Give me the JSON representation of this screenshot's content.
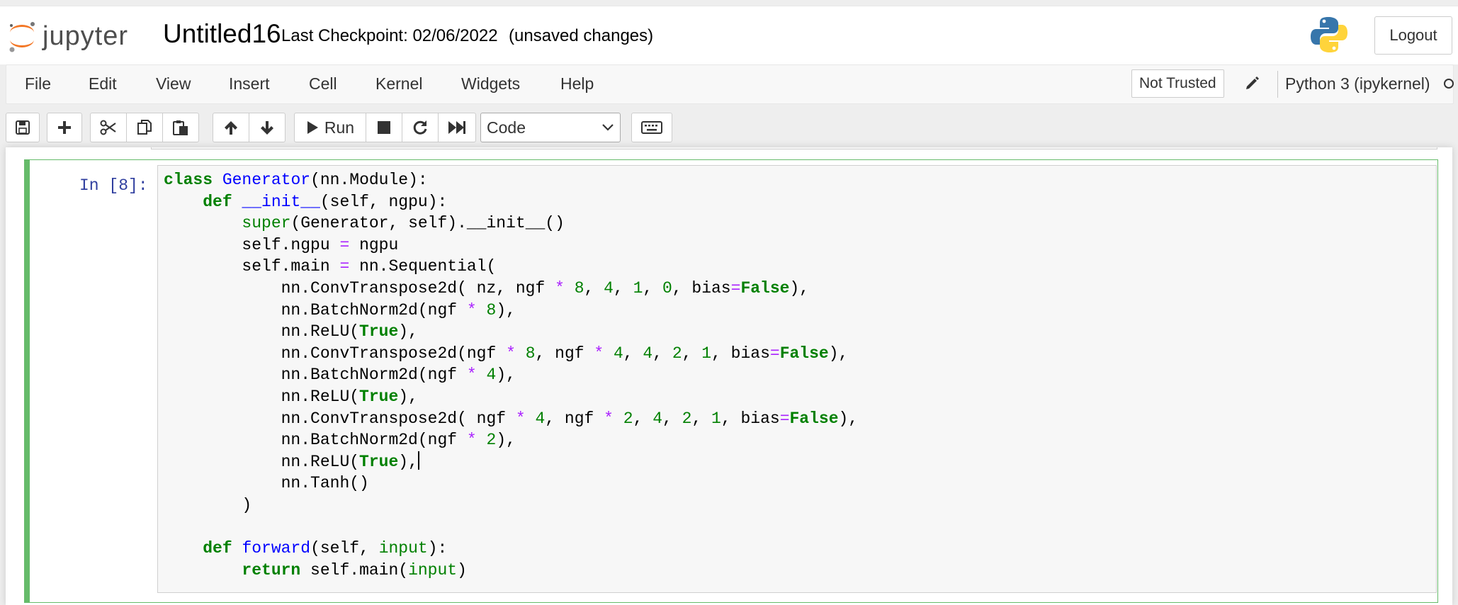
{
  "header": {
    "logo_text": "jupyter",
    "notebook_name": "Untitled16",
    "checkpoint": "Last Checkpoint: 02/06/2022",
    "unsaved": "(unsaved changes)",
    "logout_label": "Logout"
  },
  "menubar": {
    "items": [
      "File",
      "Edit",
      "View",
      "Insert",
      "Cell",
      "Kernel",
      "Widgets",
      "Help"
    ],
    "trust_label": "Not Trusted",
    "kernel_name": "Python 3 (ipykernel)"
  },
  "toolbar": {
    "run_label": "Run",
    "cell_type": "Code",
    "icons": [
      "save-icon",
      "plus-icon",
      "scissors-icon",
      "copy-icon",
      "paste-icon",
      "arrow-up-icon",
      "arrow-down-icon",
      "play-icon",
      "stop-icon",
      "restart-icon",
      "fast-forward-icon",
      "keyboard-icon"
    ]
  },
  "cell": {
    "prompt": "In [8]:",
    "lines": [
      [
        [
          "kw",
          "class"
        ],
        [
          "p",
          " "
        ],
        [
          "def",
          "Generator"
        ],
        [
          "p",
          "(nn.Module):"
        ]
      ],
      [
        [
          "p",
          "    "
        ],
        [
          "kw",
          "def"
        ],
        [
          "p",
          " "
        ],
        [
          "def",
          "__init__"
        ],
        [
          "p",
          "(self, ngpu):"
        ]
      ],
      [
        [
          "p",
          "        "
        ],
        [
          "bi",
          "super"
        ],
        [
          "p",
          "(Generator, self).__init__()"
        ]
      ],
      [
        [
          "p",
          "        self.ngpu "
        ],
        [
          "op",
          "="
        ],
        [
          "p",
          " ngpu"
        ]
      ],
      [
        [
          "p",
          "        self.main "
        ],
        [
          "op",
          "="
        ],
        [
          "p",
          " nn.Sequential("
        ]
      ],
      [
        [
          "p",
          "            nn.ConvTranspose2d( nz, ngf "
        ],
        [
          "op",
          "*"
        ],
        [
          "p",
          " "
        ],
        [
          "num",
          "8"
        ],
        [
          "p",
          ", "
        ],
        [
          "num",
          "4"
        ],
        [
          "p",
          ", "
        ],
        [
          "num",
          "1"
        ],
        [
          "p",
          ", "
        ],
        [
          "num",
          "0"
        ],
        [
          "p",
          ", bias"
        ],
        [
          "op",
          "="
        ],
        [
          "kw",
          "False"
        ],
        [
          "p",
          "),"
        ]
      ],
      [
        [
          "p",
          "            nn.BatchNorm2d(ngf "
        ],
        [
          "op",
          "*"
        ],
        [
          "p",
          " "
        ],
        [
          "num",
          "8"
        ],
        [
          "p",
          "),"
        ]
      ],
      [
        [
          "p",
          "            nn.ReLU("
        ],
        [
          "kw",
          "True"
        ],
        [
          "p",
          "),"
        ]
      ],
      [
        [
          "p",
          "            nn.ConvTranspose2d(ngf "
        ],
        [
          "op",
          "*"
        ],
        [
          "p",
          " "
        ],
        [
          "num",
          "8"
        ],
        [
          "p",
          ", ngf "
        ],
        [
          "op",
          "*"
        ],
        [
          "p",
          " "
        ],
        [
          "num",
          "4"
        ],
        [
          "p",
          ", "
        ],
        [
          "num",
          "4"
        ],
        [
          "p",
          ", "
        ],
        [
          "num",
          "2"
        ],
        [
          "p",
          ", "
        ],
        [
          "num",
          "1"
        ],
        [
          "p",
          ", bias"
        ],
        [
          "op",
          "="
        ],
        [
          "kw",
          "False"
        ],
        [
          "p",
          "),"
        ]
      ],
      [
        [
          "p",
          "            nn.BatchNorm2d(ngf "
        ],
        [
          "op",
          "*"
        ],
        [
          "p",
          " "
        ],
        [
          "num",
          "4"
        ],
        [
          "p",
          "),"
        ]
      ],
      [
        [
          "p",
          "            nn.ReLU("
        ],
        [
          "kw",
          "True"
        ],
        [
          "p",
          "),"
        ]
      ],
      [
        [
          "p",
          "            nn.ConvTranspose2d( ngf "
        ],
        [
          "op",
          "*"
        ],
        [
          "p",
          " "
        ],
        [
          "num",
          "4"
        ],
        [
          "p",
          ", ngf "
        ],
        [
          "op",
          "*"
        ],
        [
          "p",
          " "
        ],
        [
          "num",
          "2"
        ],
        [
          "p",
          ", "
        ],
        [
          "num",
          "4"
        ],
        [
          "p",
          ", "
        ],
        [
          "num",
          "2"
        ],
        [
          "p",
          ", "
        ],
        [
          "num",
          "1"
        ],
        [
          "p",
          ", bias"
        ],
        [
          "op",
          "="
        ],
        [
          "kw",
          "False"
        ],
        [
          "p",
          "),"
        ]
      ],
      [
        [
          "p",
          "            nn.BatchNorm2d(ngf "
        ],
        [
          "op",
          "*"
        ],
        [
          "p",
          " "
        ],
        [
          "num",
          "2"
        ],
        [
          "p",
          "),"
        ]
      ],
      [
        [
          "p",
          "            nn.ReLU("
        ],
        [
          "kw",
          "True"
        ],
        [
          "p",
          "),"
        ],
        [
          "cursor",
          ""
        ]
      ],
      [
        [
          "p",
          "            nn.Tanh()"
        ]
      ],
      [
        [
          "p",
          "        )"
        ]
      ],
      [
        [
          "p",
          ""
        ]
      ],
      [
        [
          "p",
          "    "
        ],
        [
          "kw",
          "def"
        ],
        [
          "p",
          " "
        ],
        [
          "def",
          "forward"
        ],
        [
          "p",
          "(self, "
        ],
        [
          "bi",
          "input"
        ],
        [
          "p",
          "):"
        ]
      ],
      [
        [
          "p",
          "        "
        ],
        [
          "kw",
          "return"
        ],
        [
          "p",
          " self.main("
        ],
        [
          "bi",
          "input"
        ],
        [
          "p",
          ")"
        ]
      ]
    ]
  },
  "colors": {
    "cell_border": "#66bb6a",
    "prompt": "#303f9f",
    "keyword": "#008000",
    "definition": "#0000ff",
    "operator": "#aa22ff"
  }
}
